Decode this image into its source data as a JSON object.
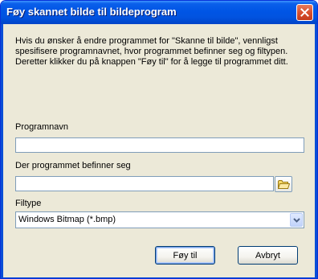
{
  "window": {
    "title": "Føy skannet bilde til bildeprogram"
  },
  "intro": {
    "text": "Hvis du ønsker å endre programmet for \"Skanne til bilde\", vennligst spesifisere programnavnet, hvor programmet befinner seg og filtypen. Deretter klikker du på knappen \"Føy til\" for å legge til programmet ditt."
  },
  "form": {
    "program_name": {
      "label": "Programnavn",
      "value": ""
    },
    "program_location": {
      "label": "Der programmet befinner seg",
      "value": ""
    },
    "file_type": {
      "label": "Filtype",
      "selected": "Windows Bitmap (*.bmp)"
    }
  },
  "buttons": {
    "add": "Føy til",
    "cancel": "Avbryt"
  },
  "colors": {
    "title_bar": "#0055e5",
    "dialog_bg": "#ece9d8",
    "close_button": "#d9512f",
    "field_border": "#7f9db9"
  },
  "icons": {
    "close": "close-icon",
    "browse": "folder-icon",
    "dropdown": "chevron-down-icon"
  }
}
